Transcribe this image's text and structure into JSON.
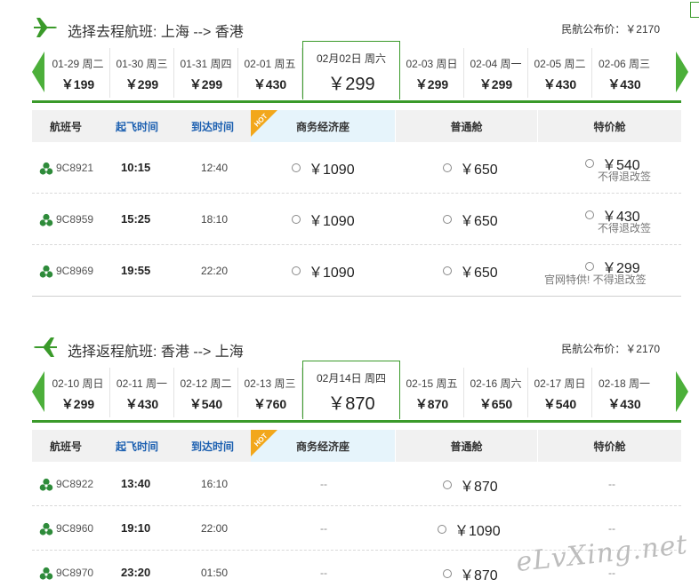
{
  "outbound": {
    "title": "选择去程航班: 上海 --> 香港",
    "public_price": "民航公布价：￥2170",
    "dates": [
      {
        "date": "01-29 周二",
        "price": "￥199"
      },
      {
        "date": "01-30 周三",
        "price": "￥299"
      },
      {
        "date": "01-31 周四",
        "price": "￥299"
      },
      {
        "date": "02-01 周五",
        "price": "￥430"
      },
      {
        "date": "02月02日 周六",
        "price": "￥299",
        "selected": true
      },
      {
        "date": "02-03 周日",
        "price": "￥299"
      },
      {
        "date": "02-04 周一",
        "price": "￥299"
      },
      {
        "date": "02-05 周二",
        "price": "￥430"
      },
      {
        "date": "02-06 周三",
        "price": "￥430"
      }
    ],
    "headers": {
      "flight": "航班号",
      "dep": "起飞时间",
      "arr": "到达时间",
      "biz": "商务经济座",
      "eco": "普通舱",
      "spc": "特价舱"
    },
    "flights": [
      {
        "no": "9C8921",
        "dep": "10:15",
        "arr": "12:40",
        "biz": "￥1090",
        "eco": "￥650",
        "spc": "￥540",
        "note": "不得退改签"
      },
      {
        "no": "9C8959",
        "dep": "15:25",
        "arr": "18:10",
        "biz": "￥1090",
        "eco": "￥650",
        "spc": "￥430",
        "note": "不得退改签"
      },
      {
        "no": "9C8969",
        "dep": "19:55",
        "arr": "22:20",
        "biz": "￥1090",
        "eco": "￥650",
        "spc": "￥299",
        "note": "官网特供! 不得退改签"
      }
    ]
  },
  "return": {
    "title": "选择返程航班: 香港 --> 上海",
    "public_price": "民航公布价：￥2170",
    "dates": [
      {
        "date": "02-10 周日",
        "price": "￥299"
      },
      {
        "date": "02-11 周一",
        "price": "￥430"
      },
      {
        "date": "02-12 周二",
        "price": "￥540"
      },
      {
        "date": "02-13 周三",
        "price": "￥760"
      },
      {
        "date": "02月14日 周四",
        "price": "￥870",
        "selected": true
      },
      {
        "date": "02-15 周五",
        "price": "￥870"
      },
      {
        "date": "02-16 周六",
        "price": "￥650"
      },
      {
        "date": "02-17 周日",
        "price": "￥540"
      },
      {
        "date": "02-18 周一",
        "price": "￥430"
      }
    ],
    "headers": {
      "flight": "航班号",
      "dep": "起飞时间",
      "arr": "到达时间",
      "biz": "商务经济座",
      "eco": "普通舱",
      "spc": "特价舱"
    },
    "flights": [
      {
        "no": "9C8922",
        "dep": "13:40",
        "arr": "16:10",
        "biz": "--",
        "eco": "￥870",
        "spc": "--"
      },
      {
        "no": "9C8960",
        "dep": "19:10",
        "arr": "22:00",
        "biz": "--",
        "eco": "￥1090",
        "spc": "--"
      },
      {
        "no": "9C8970",
        "dep": "23:20",
        "arr": "01:50",
        "biz": "--",
        "eco": "￥870",
        "spc": "--"
      }
    ]
  },
  "hot_badge": "HOT",
  "watermark": "eLvXing.net",
  "colors": {
    "accent_green": "#3a9a2a",
    "header_blue": "#1b5fb0",
    "hot_orange": "#f2a71b",
    "biz_header_bg": "#e6f4fb"
  },
  "icons": {
    "plane": "airplane-icon",
    "airline": "spring-airlines-logo-icon",
    "arrow_left": "arrow-left-icon",
    "arrow_right": "arrow-right-icon"
  }
}
